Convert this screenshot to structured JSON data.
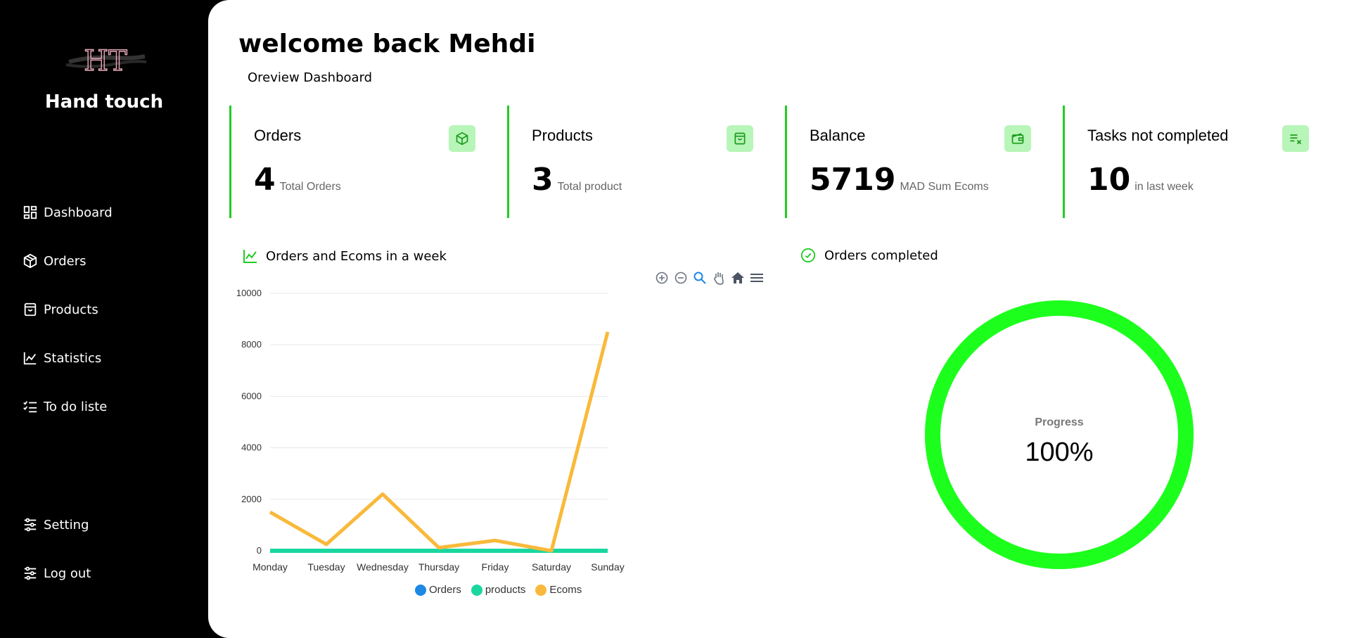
{
  "sidebar": {
    "brand": "Hand touch",
    "logo_text": "HT",
    "nav": [
      {
        "label": "Dashboard",
        "icon": "dashboard-icon"
      },
      {
        "label": "Orders",
        "icon": "box-icon"
      },
      {
        "label": "Products",
        "icon": "bag-icon"
      },
      {
        "label": "Statistics",
        "icon": "chart-line-icon"
      },
      {
        "label": "To do liste",
        "icon": "checklist-icon"
      }
    ],
    "bottom_nav": [
      {
        "label": "Setting",
        "icon": "sliders-icon"
      },
      {
        "label": "Log out",
        "icon": "sliders-icon"
      }
    ]
  },
  "header": {
    "welcome": "welcome back Mehdi",
    "subtitle": "Oreview Dashboard"
  },
  "cards": [
    {
      "title": "Orders",
      "value": "4",
      "desc": "Total Orders",
      "icon": "box-icon"
    },
    {
      "title": "Products",
      "value": "3",
      "desc": "Total product",
      "icon": "bag-icon"
    },
    {
      "title": "Balance",
      "value": "5719",
      "desc": "MAD Sum Ecoms",
      "icon": "wallet-icon"
    },
    {
      "title": "Tasks not completed",
      "value": "10",
      "desc": "in last week",
      "icon": "list-x-icon"
    }
  ],
  "colors": {
    "accent": "#22cc22",
    "icon_bg": "#b8f5b8",
    "orders": "#1e88e5",
    "products": "#1ad7a0",
    "ecoms": "#f9b93a",
    "ring": "#1cff1c"
  },
  "chart_panel": {
    "title": "Orders and Ecoms in a week",
    "toolbar": [
      "zoom-in-icon",
      "zoom-out-icon",
      "zoom-select-icon",
      "pan-hand-icon",
      "home-icon",
      "menu-icon"
    ]
  },
  "chart_data": {
    "type": "line",
    "categories": [
      "Monday",
      "Tuesday",
      "Wednesday",
      "Thursday",
      "Friday",
      "Saturday",
      "Sunday"
    ],
    "series": [
      {
        "name": "Orders",
        "values": [
          0,
          0,
          0,
          0,
          0,
          0,
          0
        ]
      },
      {
        "name": "products",
        "values": [
          0,
          0,
          0,
          0,
          0,
          0,
          0
        ]
      },
      {
        "name": "Ecoms",
        "values": [
          1500,
          250,
          2200,
          120,
          400,
          0,
          8500
        ]
      }
    ],
    "yticks": [
      0,
      2000,
      4000,
      6000,
      8000,
      10000
    ],
    "ylim": [
      0,
      10000
    ],
    "grid": true,
    "legend": "bottom"
  },
  "progress_panel": {
    "title": "Orders completed",
    "label": "Progress",
    "value_text": "100%",
    "value": 1.0
  }
}
